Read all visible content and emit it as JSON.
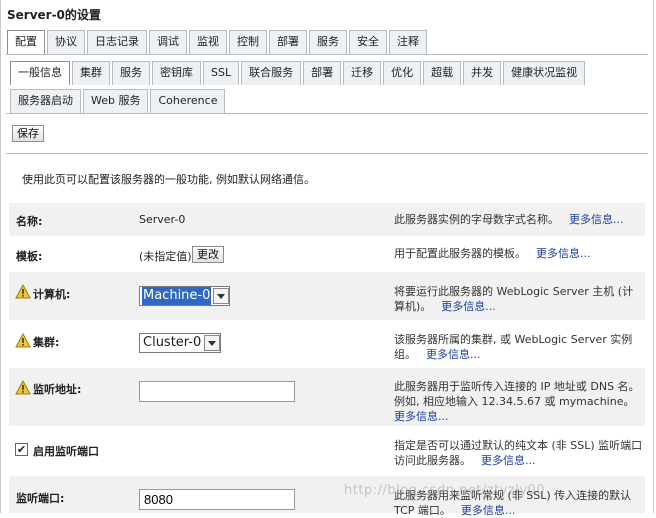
{
  "page_title": "Server-0的设置",
  "tabs_primary": [
    "配置",
    "协议",
    "日志记录",
    "调试",
    "监视",
    "控制",
    "部署",
    "服务",
    "安全",
    "注释"
  ],
  "tabs_secondary_row1": [
    "一般信息",
    "集群",
    "服务",
    "密钥库",
    "SSL",
    "联合服务",
    "部署",
    "迁移",
    "优化",
    "超载",
    "并发",
    "健康状况监视"
  ],
  "tabs_secondary_row2": [
    "服务器启动",
    "Web 服务",
    "Coherence"
  ],
  "save_label": "保存",
  "description": "使用此页可以配置该服务器的一般功能, 例如默认网络通信。",
  "more_info": "更多信息...",
  "fields": {
    "name": {
      "label": "名称:",
      "value": "Server-0",
      "help": "此服务器实例的字母数字式名称。"
    },
    "template": {
      "label": "模板:",
      "value": "(未指定值)",
      "button": "更改",
      "help": "用于配置此服务器的模板。"
    },
    "machine": {
      "label": "计算机:",
      "value": "Machine-0",
      "help": "将要运行此服务器的 WebLogic Server 主机 (计算机)。"
    },
    "cluster": {
      "label": "集群:",
      "value": "Cluster-0",
      "help": "该服务器所属的集群, 或 WebLogic Server 实例组。"
    },
    "listen_address": {
      "label": "监听地址:",
      "value": "",
      "help": "此服务器用于监听传入连接的 IP 地址或 DNS 名。例如, 相应地输入 12.34.5.67 或 mymachine。"
    },
    "listen_port_enabled": {
      "label": "启用监听端口",
      "checked": true,
      "help": "指定是否可以通过默认的纯文本 (非 SSL) 监听端口访问此服务器。"
    },
    "listen_port": {
      "label": "监听端口:",
      "value": "8080",
      "help": "此服务器用来监听常规 (非 SSL) 传入连接的默认 TCP 端口。"
    }
  },
  "watermark": "http://blog.csdn.net/ztyzly00"
}
